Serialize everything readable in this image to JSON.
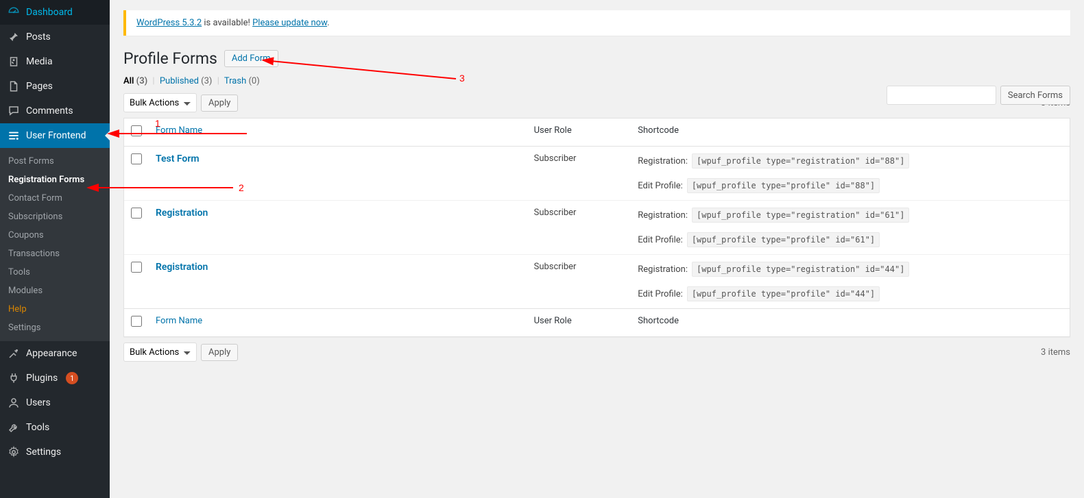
{
  "sidebar": {
    "items": [
      {
        "icon": "dashboard",
        "label": "Dashboard"
      },
      {
        "icon": "pin",
        "label": "Posts"
      },
      {
        "icon": "media",
        "label": "Media"
      },
      {
        "icon": "page",
        "label": "Pages"
      },
      {
        "icon": "comment",
        "label": "Comments"
      },
      {
        "icon": "wpuf",
        "label": "User Frontend",
        "active": true
      },
      {
        "icon": "appearance",
        "label": "Appearance"
      },
      {
        "icon": "plugin",
        "label": "Plugins",
        "badge": "1"
      },
      {
        "icon": "users",
        "label": "Users"
      },
      {
        "icon": "tools",
        "label": "Tools"
      },
      {
        "icon": "settings",
        "label": "Settings"
      }
    ],
    "submenu": [
      {
        "label": "Post Forms"
      },
      {
        "label": "Registration Forms",
        "current": true
      },
      {
        "label": "Contact Form"
      },
      {
        "label": "Subscriptions"
      },
      {
        "label": "Coupons"
      },
      {
        "label": "Transactions"
      },
      {
        "label": "Tools"
      },
      {
        "label": "Modules"
      },
      {
        "label": "Help",
        "help": true
      },
      {
        "label": "Settings"
      }
    ]
  },
  "notice": {
    "version_link": "WordPress 5.3.2",
    "mid_text": " is available! ",
    "update_link": "Please update now",
    "end": "."
  },
  "page": {
    "title": "Profile Forms",
    "add_btn": "Add Form"
  },
  "filters": {
    "all": "All",
    "all_count": "(3)",
    "published": "Published",
    "published_count": "(3)",
    "trash": "Trash",
    "trash_count": "(0)"
  },
  "bulk": {
    "label": "Bulk Actions",
    "apply": "Apply"
  },
  "search": {
    "btn": "Search Forms"
  },
  "items_count": "3 items",
  "table": {
    "h_name": "Form Name",
    "h_role": "User Role",
    "h_code": "Shortcode",
    "reg_prefix": "Registration:",
    "edit_prefix": "Edit Profile:",
    "rows": [
      {
        "name": "Test Form",
        "role": "Subscriber",
        "reg_code": "[wpuf_profile type=\"registration\" id=\"88\"]",
        "edit_code": "[wpuf_profile type=\"profile\" id=\"88\"]"
      },
      {
        "name": "Registration",
        "role": "Subscriber",
        "reg_code": "[wpuf_profile type=\"registration\" id=\"61\"]",
        "edit_code": "[wpuf_profile type=\"profile\" id=\"61\"]"
      },
      {
        "name": "Registration",
        "role": "Subscriber",
        "reg_code": "[wpuf_profile type=\"registration\" id=\"44\"]",
        "edit_code": "[wpuf_profile type=\"profile\" id=\"44\"]"
      }
    ]
  },
  "annotations": {
    "n1": "1",
    "n2": "2",
    "n3": "3"
  }
}
